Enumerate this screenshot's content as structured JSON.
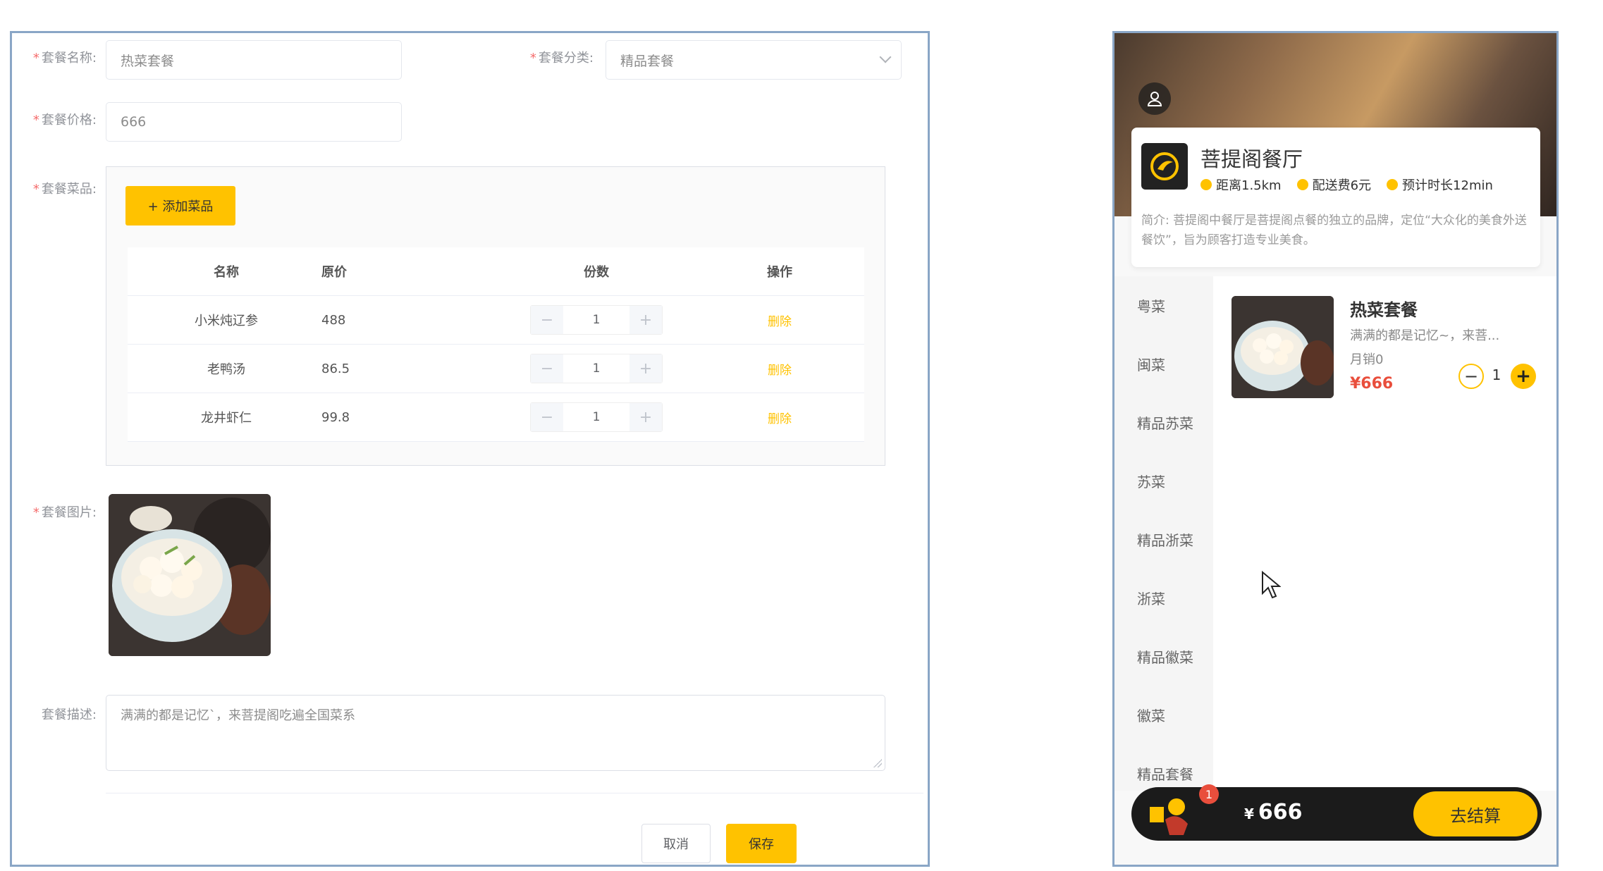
{
  "form": {
    "name_label": "套餐名称:",
    "name_value": "热菜套餐",
    "category_label": "套餐分类:",
    "category_value": "精品套餐",
    "price_label": "套餐价格:",
    "price_value": "666",
    "dishes_label": "套餐菜品:",
    "add_dish_label": "+ 添加菜品",
    "columns": [
      "名称",
      "原价",
      "份数",
      "操作"
    ],
    "rows": [
      {
        "name": "小米炖辽参",
        "price": "488",
        "qty": "1",
        "action": "删除"
      },
      {
        "name": "老鸭汤",
        "price": "86.5",
        "qty": "1",
        "action": "删除"
      },
      {
        "name": "龙井虾仁",
        "price": "99.8",
        "qty": "1",
        "action": "删除"
      }
    ],
    "image_label": "套餐图片:",
    "desc_label": "套餐描述:",
    "desc_value": "满满的都是记忆`，来菩提阁吃遍全国菜系",
    "cancel_label": "取消",
    "save_label": "保存",
    "accent_color": "#ffc200",
    "required_color": "#f56c6c"
  },
  "mobile": {
    "shop_name": "菩提阁餐厅",
    "distance": "距离1.5km",
    "delivery_fee": "配送费6元",
    "eta": "预计时长12min",
    "intro": "简介: 菩提阁中餐厅是菩提阁点餐的独立的品牌，定位“大众化的美食外送餐饮”，旨为顾客打造专业美食。",
    "categories": [
      "粤菜",
      "闽菜",
      "精品苏菜",
      "苏菜",
      "精品浙菜",
      "浙菜",
      "精品徽菜",
      "徽菜",
      "精品套餐"
    ],
    "dish": {
      "title": "热菜套餐",
      "desc": "满满的都是记忆~，来菩...",
      "sales": "月销0",
      "price": "¥666",
      "qty": "1"
    },
    "cart": {
      "badge": "1",
      "currency": "¥",
      "total": "666",
      "checkout_label": "去结算"
    },
    "price_color": "#e94e3c"
  }
}
